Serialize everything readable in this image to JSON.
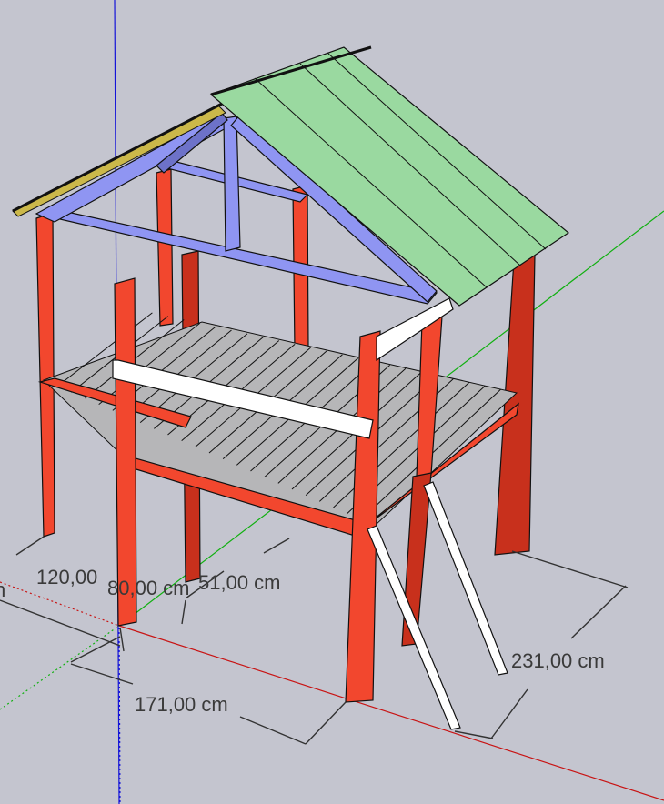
{
  "colors": {
    "background": "#c4c5cf",
    "posts": "#f2472e",
    "truss": "#8f95f2",
    "roof": "#9ad9a0",
    "deck": "#b6b6b8",
    "rail": "#ffffff",
    "axis_red": "#c81414",
    "axis_green": "#10b010",
    "axis_blue": "#1414d8"
  },
  "model": {
    "name": "",
    "components": [
      "posts",
      "deck",
      "truss",
      "roof",
      "rail",
      "ladder"
    ]
  },
  "dimensions": {
    "left_depth": "120,00",
    "left_width": "80,00 cm",
    "right_offset": "51,00 cm",
    "front_width": "171,00 cm",
    "height": "231,00 cm",
    "edge_fragment": "n"
  }
}
